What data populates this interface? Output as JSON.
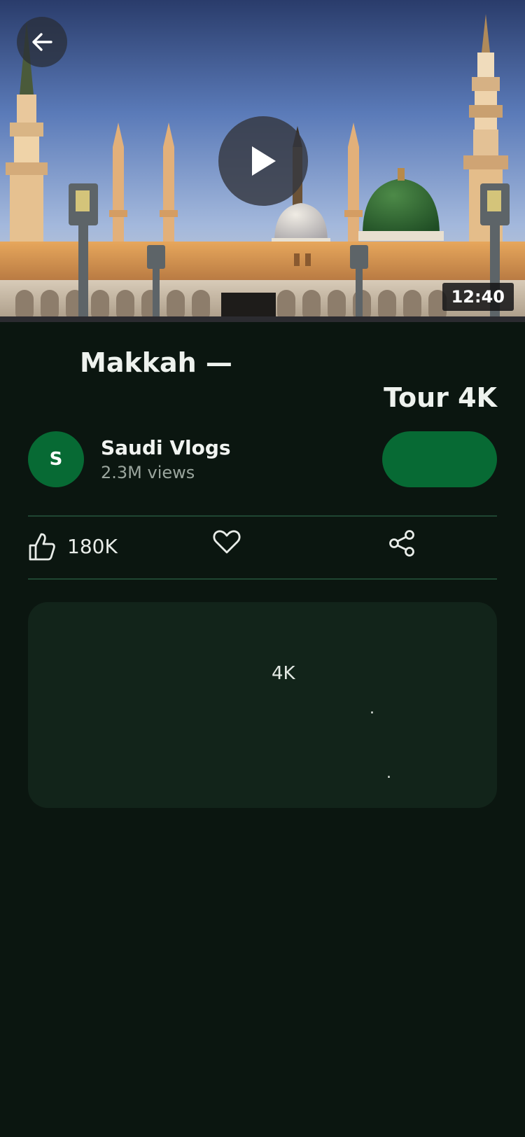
{
  "video": {
    "duration": "12:40",
    "title_line1": "Makkah —",
    "title_line2": "Tour 4K"
  },
  "channel": {
    "avatar_letter": "S",
    "name": "Saudi Vlogs",
    "views": "2.3M views",
    "subscribe_label": ""
  },
  "actions": {
    "like_count": "180K"
  },
  "description": {
    "text1": "4K",
    "text2": ".",
    "text3": "."
  },
  "colors": {
    "background": "#0b1610",
    "accent": "#076a34",
    "card": "#12241a",
    "divider": "#1f4632"
  },
  "icons": {
    "back": "arrow-left-icon",
    "play": "play-icon",
    "like": "thumbs-up-icon",
    "favorite": "heart-icon",
    "share": "share-icon"
  }
}
